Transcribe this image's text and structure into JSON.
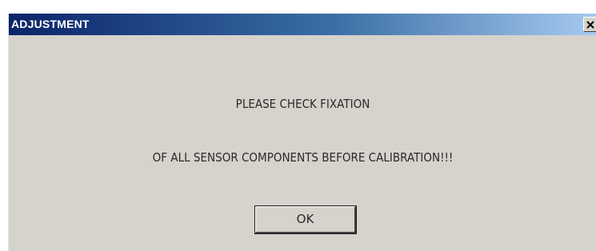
{
  "dialog": {
    "title": "ADJUSTMENT",
    "close_icon": "close-icon",
    "message_line_1": "PLEASE CHECK FIXATION",
    "message_line_2": "OF ALL SENSOR COMPONENTS BEFORE CALIBRATION!!!",
    "ok_label": "OK"
  },
  "colors": {
    "titlebar_start": "#0a246a",
    "titlebar_end": "#a6caf0",
    "dialog_background": "#d6d2cc"
  }
}
